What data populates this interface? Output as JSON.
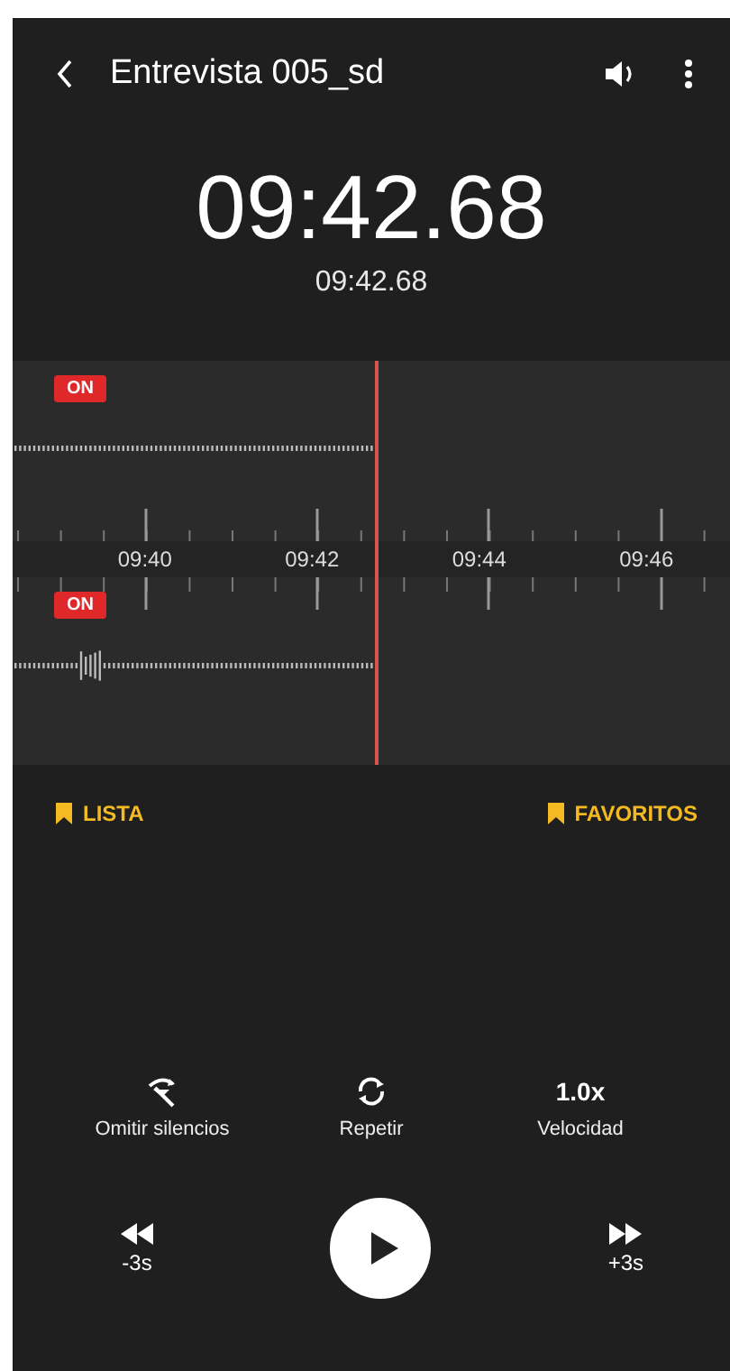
{
  "header": {
    "title": "Entrevista 005_sd"
  },
  "elapsed": "09:42.68",
  "total": "09:42.68",
  "tracks": [
    {
      "badge": "ON"
    },
    {
      "badge": "ON"
    }
  ],
  "timeline": [
    "09:40",
    "09:42",
    "09:44",
    "09:46"
  ],
  "bookmarks": {
    "left": "LISTA",
    "right": "FAVORITOS"
  },
  "options": [
    {
      "kind": "skip",
      "label": "Omitir silencios"
    },
    {
      "kind": "repeat",
      "label": "Repetir"
    },
    {
      "kind": "speed",
      "value": "1.0x",
      "label": "Velocidad"
    }
  ],
  "transport": {
    "back": "-3s",
    "forward": "+3s"
  }
}
